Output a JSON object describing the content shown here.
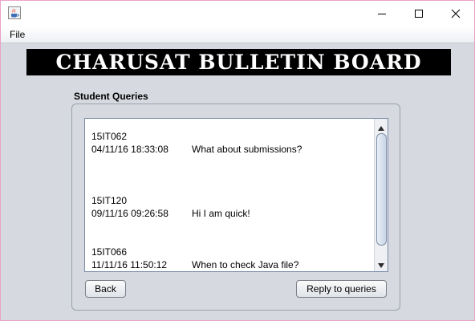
{
  "menu": {
    "file": "File"
  },
  "banner": {
    "text": "CHARUSAT BULLETIN BOARD"
  },
  "panel": {
    "title": "Student Queries"
  },
  "queries": [
    {
      "id": "15IT062",
      "datetime": "04/11/16 18:33:08",
      "message": "What about submissions?"
    },
    {
      "id": "15IT120",
      "datetime": "09/11/16 09:26:58",
      "message": "Hi I am quick!"
    },
    {
      "id": "15IT066",
      "datetime": "11/11/16 11:50:12",
      "message": "When to check Java file?"
    }
  ],
  "buttons": {
    "back": "Back",
    "reply": "Reply to queries"
  },
  "colors": {
    "banner_bg": "#000000",
    "banner_text": "#ffffff",
    "window_bg": "#d6d9df",
    "border_accent": "#e8a3c7"
  },
  "icons": {
    "app": "java-cup-icon",
    "minimize": "minimize-icon",
    "maximize": "maximize-icon",
    "close": "close-icon",
    "scroll_up": "scroll-up-arrow-icon",
    "scroll_down": "scroll-down-arrow-icon"
  }
}
